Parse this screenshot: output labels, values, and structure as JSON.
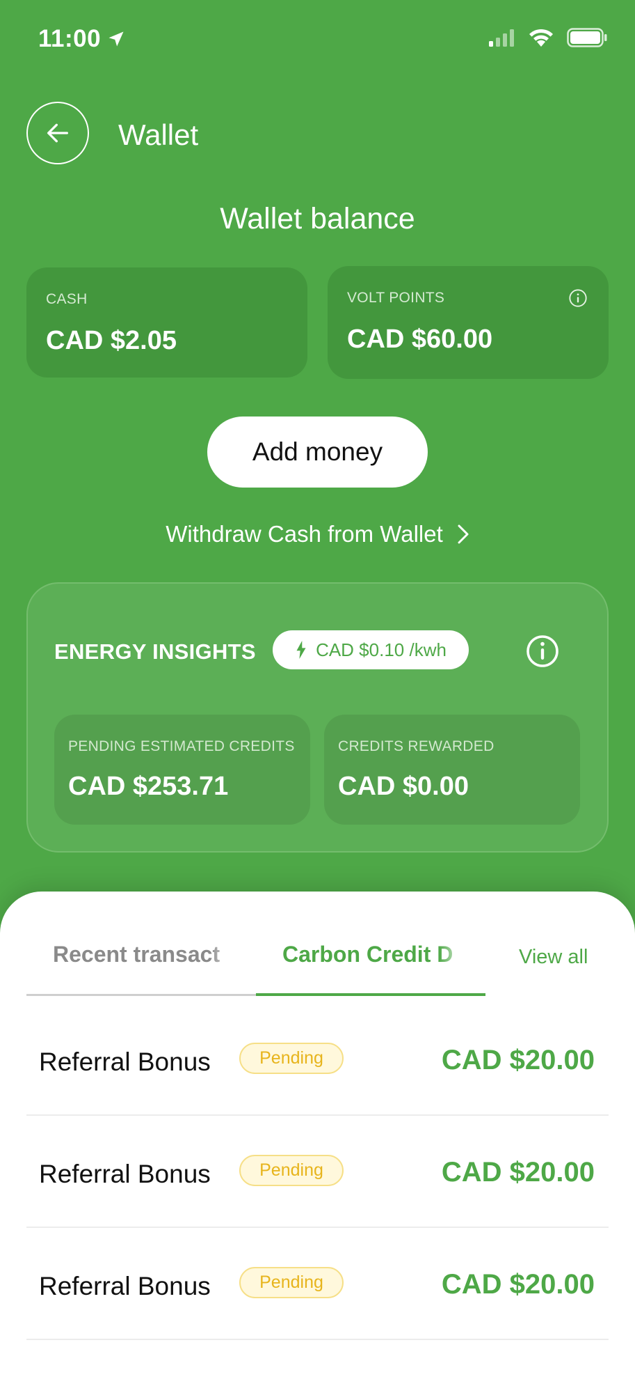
{
  "status_bar": {
    "time": "11:00"
  },
  "header": {
    "title": "Wallet"
  },
  "wallet": {
    "section_title": "Wallet balance",
    "cash": {
      "label": "CASH",
      "value": "CAD $2.05"
    },
    "volt_points": {
      "label": "VOLT POINTS",
      "value": "CAD $60.00"
    },
    "add_money_label": "Add money",
    "withdraw_label": "Withdraw Cash from Wallet"
  },
  "energy_insights": {
    "title": "ENERGY INSIGHTS",
    "rate": "CAD $0.10 /kwh",
    "pending": {
      "label": "PENDING ESTIMATED CREDITS",
      "value": "CAD $253.71"
    },
    "rewarded": {
      "label": "CREDITS REWARDED",
      "value": "CAD $0.00"
    }
  },
  "tabs": {
    "recent": "Recent transact",
    "carbon": "Carbon Credit D",
    "view_all": "View all"
  },
  "transactions": [
    {
      "name": "Referral Bonus",
      "status": "Pending",
      "amount": "CAD $20.00"
    },
    {
      "name": "Referral Bonus",
      "status": "Pending",
      "amount": "CAD $20.00"
    },
    {
      "name": "Referral Bonus",
      "status": "Pending",
      "amount": "CAD $20.00"
    }
  ],
  "colors": {
    "primary_green": "#4ea847",
    "pending_yellow": "#e7b41c"
  }
}
